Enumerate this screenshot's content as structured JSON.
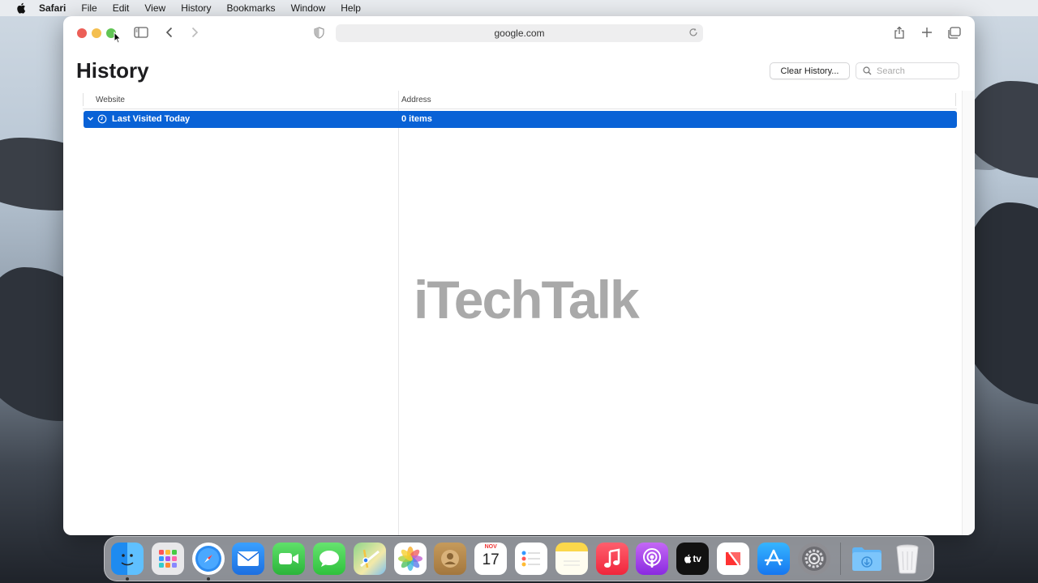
{
  "menubar": {
    "app": "Safari",
    "items": [
      "File",
      "Edit",
      "View",
      "History",
      "Bookmarks",
      "Window",
      "Help"
    ]
  },
  "toolbar": {
    "url": "google.com"
  },
  "history": {
    "title": "History",
    "clear_button": "Clear History...",
    "search_placeholder": "Search",
    "columns": {
      "website": "Website",
      "address": "Address"
    },
    "rows": [
      {
        "label": "Last Visited Today",
        "count": "0 items"
      }
    ]
  },
  "watermark": "iTechTalk",
  "dock": {
    "calendar_month": "NOV",
    "calendar_day": "17",
    "tv_label": "tv",
    "apps": [
      "finder-icon",
      "launchpad-icon",
      "safari-icon",
      "mail-icon",
      "facetime-icon",
      "messages-icon",
      "maps-icon",
      "photos-icon",
      "contacts-icon",
      "calendar-icon",
      "reminders-icon",
      "notes-icon",
      "music-icon",
      "podcasts-icon",
      "tv-icon",
      "news-icon",
      "app-store-icon",
      "system-preferences-icon",
      "downloads-folder-icon",
      "trash-icon"
    ]
  },
  "colors": {
    "selection": "#0962d6",
    "close": "#ec5f57",
    "minimize": "#f4bf4f",
    "zoom": "#61c554"
  }
}
